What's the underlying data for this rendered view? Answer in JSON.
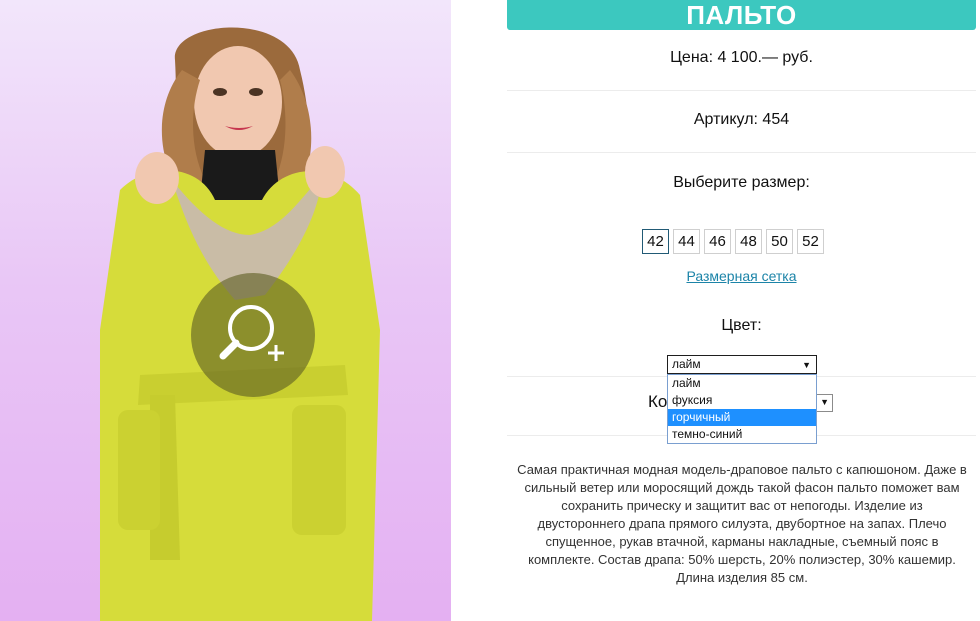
{
  "product": {
    "title": "ПАЛЬТО",
    "price": "Цена: 4 100.— руб.",
    "article": "Артикул: 454",
    "choose_size_label": "Выберите размер:",
    "sizes": [
      "42",
      "44",
      "46",
      "48",
      "50",
      "52"
    ],
    "selected_size": "42",
    "size_chart_link": "Размерная сетка",
    "color_label": "Цвет:",
    "color_selected": "лайм",
    "color_options": [
      "лайм",
      "фуксия",
      "горчичный",
      "темно-синий"
    ],
    "color_highlighted": "горчичный",
    "quantity_label_partial": "Ко",
    "description": "Самая практичная модная модель-драповое пальто с капюшоном. Даже в сильный ветер или моросящий дождь такой фасон пальто поможет вам сохранить прическу и защитит вас от непогоды. Изделие из двустороннего драпа прямого силуэта, двубортное на запах. Плечо спущенное, рукав втачной, карманы накладные, съемный пояс в комплекте. Состав драпа: 50% шерсть, 20% полиэстер, 30% кашемир. Длина изделия 85 см."
  },
  "colors": {
    "accent": "#3cc8bf",
    "link": "#1c84a8",
    "highlight": "#1e90ff",
    "coat": "#d7dd3c"
  },
  "icons": {
    "zoom": "zoom-in-icon",
    "dropdown_arrow": "triangle-down-icon"
  }
}
